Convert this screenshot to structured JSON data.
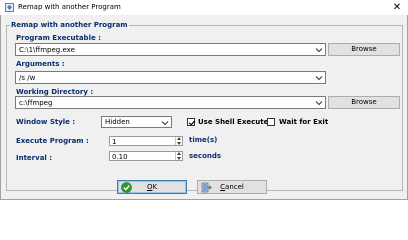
{
  "window": {
    "title": "Remap with another Program",
    "close_glyph": "✕"
  },
  "group": {
    "label": "Remap with another Program"
  },
  "program_executable": {
    "label": "Program Executable :",
    "value": "C:\\1\\ffmpeg.exe",
    "browse_label": "Browse"
  },
  "arguments": {
    "label": "Arguments :",
    "value": "/s /w"
  },
  "working_directory": {
    "label": "Working Directory :",
    "value": "c:\\ffmpeg",
    "browse_label": "Browse"
  },
  "window_style": {
    "label": "Window Style :",
    "value": "Hidden"
  },
  "use_shell_execute": {
    "label": "Use Shell Execute",
    "checked": true
  },
  "wait_for_exit": {
    "label": "Wait for Exit",
    "checked": false
  },
  "execute_program": {
    "label": "Execute Program :",
    "value": "1",
    "unit": "time(s)"
  },
  "interval": {
    "label": "Interval :",
    "value": "0.10",
    "unit": "seconds"
  },
  "buttons": {
    "ok": {
      "mnemonic": "O",
      "rest": "K",
      "icon": "ok-check-icon"
    },
    "cancel": {
      "mnemonic": "C",
      "rest": "ancel",
      "icon": "cancel-door-icon"
    }
  },
  "colors": {
    "label_blue": "#0b2e6e",
    "ok_green": "#2e9a2e"
  }
}
